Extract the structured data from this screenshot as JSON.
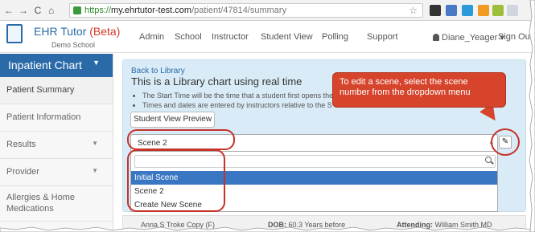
{
  "browser": {
    "url_secure": "https://",
    "url_host": "my.ehrtutor-test.com",
    "url_path": "/patient/47814/summary"
  },
  "header": {
    "brand": "EHR Tutor",
    "beta": "(Beta)",
    "school": "Demo School",
    "nav": [
      "Admin",
      "School",
      "Instructor",
      "Student View",
      "Polling",
      "Support"
    ],
    "user": "Diane_Yeager",
    "signout": "Sign Out"
  },
  "sidebar": {
    "heading": "Inpatient Chart",
    "items": [
      {
        "label": "Patient Summary"
      },
      {
        "label": "Patient Information"
      },
      {
        "label": "Results"
      },
      {
        "label": "Provider"
      },
      {
        "label": "Allergies & Home Medications"
      }
    ]
  },
  "main": {
    "back_link": "Back to Library",
    "title": "This is a Library chart using real time",
    "bullets": [
      "The Start Time will be the time that a student first opens the",
      "Times and dates are entered by instructors relative to the S"
    ],
    "preview_button": "Student View Preview",
    "scene_selected": "Scene 2",
    "scene_options": [
      "Initial Scene",
      "Scene 2",
      "Create New Scene"
    ]
  },
  "callout": {
    "text": "To edit a scene, select the scene number from the dropdown menu"
  },
  "patient_bar": {
    "name": "Anna S Troke Copy (F)",
    "dob_label": "DOB:",
    "dob_value": "60.3 Years before",
    "attending_label": "Attending:",
    "attending_value": "William Smith MD"
  },
  "colors": {
    "brand_blue": "#2a6aa8",
    "callout_red": "#d6442c",
    "selected_option": "#3a77c2",
    "panel_bg": "#d9ebf6"
  }
}
